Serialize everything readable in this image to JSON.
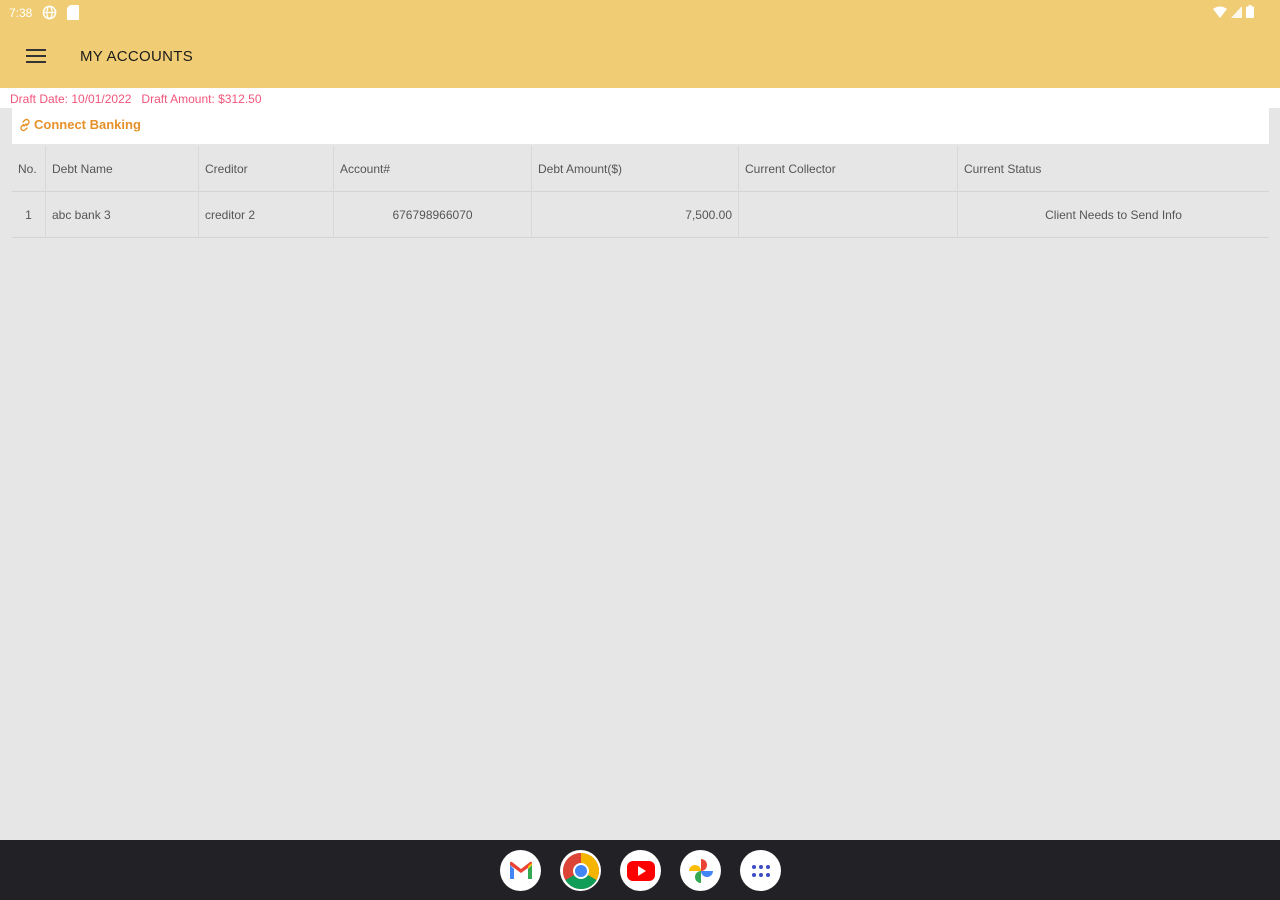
{
  "status_bar": {
    "time": "7:38",
    "icons": [
      "globe-icon",
      "sd-card-icon",
      "wifi-icon",
      "signal-icon",
      "battery-icon"
    ]
  },
  "app_bar": {
    "title": "MY ACCOUNTS",
    "menu_icon": "hamburger-menu-icon"
  },
  "draft": {
    "date": "Draft Date: 10/01/2022",
    "amount": "Draft Amount: $312.50"
  },
  "connect_banking": {
    "label": "Connect Banking",
    "icon": "link-icon"
  },
  "table": {
    "headers": [
      "No.",
      "Debt Name",
      "Creditor",
      "Account#",
      "Debt Amount($)",
      "Current Collector",
      "Current Status"
    ],
    "rows": [
      [
        "1",
        "abc bank 3",
        "creditor 2",
        "676798966070",
        "7,500.00",
        "",
        "Client Needs to Send Info"
      ]
    ]
  },
  "dock": {
    "apps": [
      "gmail-icon",
      "chrome-icon",
      "youtube-icon",
      "photos-icon",
      "app-drawer-icon"
    ]
  },
  "colors": {
    "app_bar": "#f0cd74",
    "draft_text": "#f2557a",
    "connect_link": "#e6912a",
    "background": "#e6e6e6",
    "dock": "#222226"
  }
}
